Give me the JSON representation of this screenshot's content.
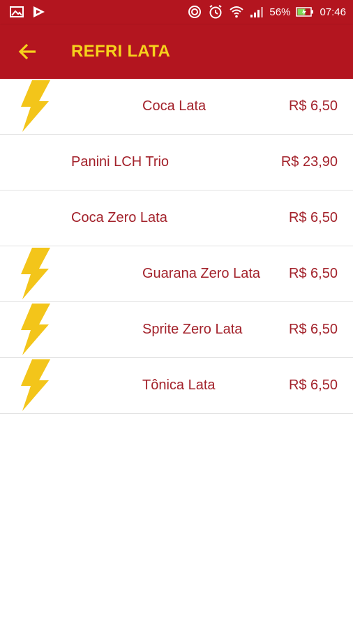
{
  "status_bar": {
    "battery": "56%",
    "time": "07:46"
  },
  "header": {
    "title": "REFRI LATA"
  },
  "colors": {
    "primary": "#b3151f",
    "accent": "#f6d21c",
    "item_text": "#a3222b"
  },
  "items": [
    {
      "name": "Coca Lata",
      "price": "R$ 6,50",
      "has_icon": true
    },
    {
      "name": "Panini LCH Trio",
      "price": "R$ 23,90",
      "has_icon": false
    },
    {
      "name": "Coca Zero Lata",
      "price": "R$ 6,50",
      "has_icon": false
    },
    {
      "name": "Guarana Zero Lata",
      "price": "R$ 6,50",
      "has_icon": true
    },
    {
      "name": "Sprite Zero Lata",
      "price": "R$ 6,50",
      "has_icon": true
    },
    {
      "name": "Tônica Lata",
      "price": "R$ 6,50",
      "has_icon": true
    }
  ]
}
